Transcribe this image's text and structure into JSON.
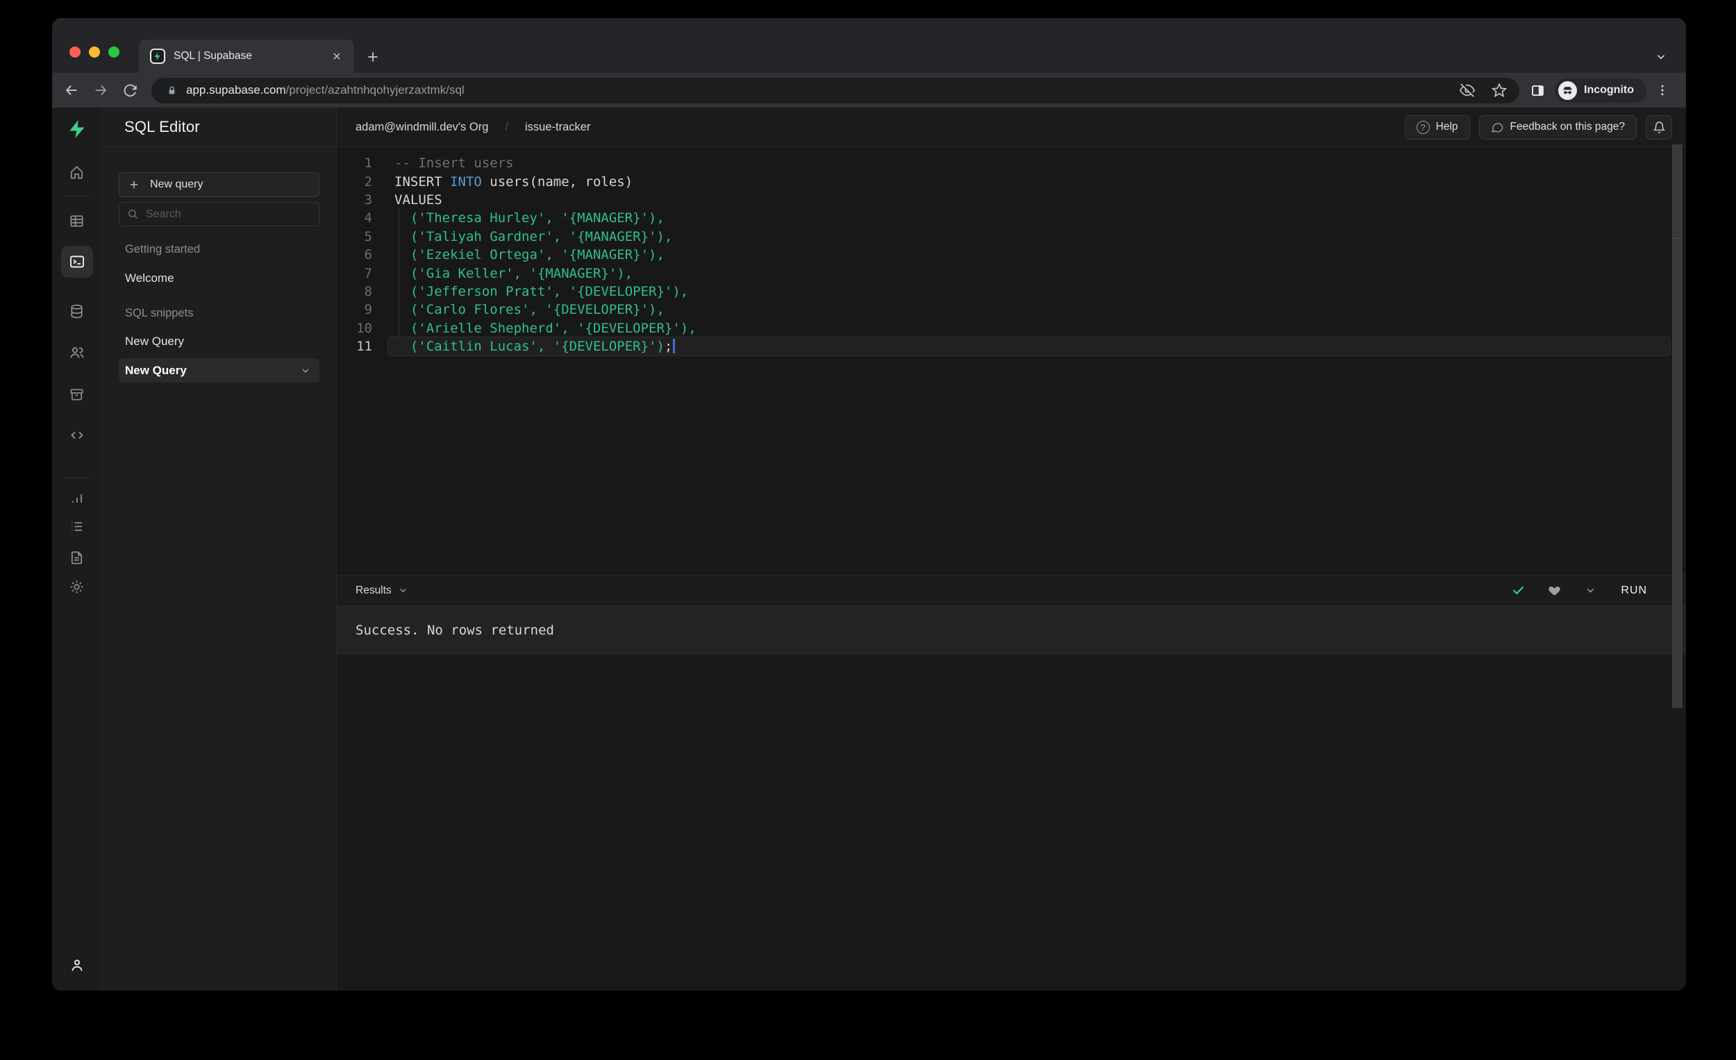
{
  "browser": {
    "tab_title": "SQL | Supabase",
    "url_host": "app.supabase.com",
    "url_path": "/project/azahtnhqohyjerzaxtmk/sql",
    "incognito_label": "Incognito",
    "icons": [
      "supabase-favicon",
      "close-tab-icon",
      "new-tab-icon",
      "tab-search-icon",
      "back-icon",
      "forward-icon",
      "reload-icon",
      "lock-icon",
      "eye-off-icon",
      "star-icon",
      "side-panel-icon",
      "incognito-spy-icon",
      "menu-dots-icon"
    ]
  },
  "sidebar": {
    "icons": [
      "supabase-logo",
      "home-icon",
      "table-editor-icon",
      "sql-editor-icon",
      "database-icon",
      "auth-users-icon",
      "storage-icon",
      "edge-functions-icon",
      "reports-icon",
      "logs-icon",
      "docs-icon",
      "settings-icon",
      "account-icon"
    ],
    "active_icon": "sql-editor-icon"
  },
  "panel": {
    "title": "SQL Editor",
    "new_query_button": "New query",
    "search_placeholder": "Search",
    "sections": [
      {
        "label": "Getting started",
        "items": [
          "Welcome"
        ]
      },
      {
        "label": "SQL snippets",
        "items": [
          "New Query",
          "New Query"
        ]
      }
    ]
  },
  "header": {
    "breadcrumb_org": "adam@windmill.dev's Org",
    "breadcrumb_sep": "/",
    "breadcrumb_project": "issue-tracker",
    "help_label": "Help",
    "help_glyph": "?",
    "feedback_label": "Feedback on this page?"
  },
  "editor": {
    "lines": [
      {
        "num": 1,
        "tokens": [
          {
            "t": "comment",
            "s": "-- Insert users"
          }
        ]
      },
      {
        "num": 2,
        "tokens": [
          {
            "t": "plain",
            "s": "INSERT "
          },
          {
            "t": "keyword",
            "s": "INTO"
          },
          {
            "t": "plain",
            "s": " users(name, roles)"
          }
        ]
      },
      {
        "num": 3,
        "tokens": [
          {
            "t": "plain",
            "s": "VALUES"
          }
        ]
      },
      {
        "num": 4,
        "tokens": [
          {
            "t": "string",
            "s": "  ('Theresa Hurley', '{MANAGER}'),"
          }
        ]
      },
      {
        "num": 5,
        "tokens": [
          {
            "t": "string",
            "s": "  ('Taliyah Gardner', '{MANAGER}'),"
          }
        ]
      },
      {
        "num": 6,
        "tokens": [
          {
            "t": "string",
            "s": "  ('Ezekiel Ortega', '{MANAGER}'),"
          }
        ]
      },
      {
        "num": 7,
        "tokens": [
          {
            "t": "string",
            "s": "  ('Gia Keller', '{MANAGER}'),"
          }
        ]
      },
      {
        "num": 8,
        "tokens": [
          {
            "t": "string",
            "s": "  ('Jefferson Pratt', '{DEVELOPER}'),"
          }
        ]
      },
      {
        "num": 9,
        "tokens": [
          {
            "t": "string",
            "s": "  ('Carlo Flores', '{DEVELOPER}'),"
          }
        ]
      },
      {
        "num": 10,
        "tokens": [
          {
            "t": "string",
            "s": "  ('Arielle Shepherd', '{DEVELOPER}'),"
          }
        ]
      },
      {
        "num": 11,
        "active": true,
        "cursor": true,
        "tokens": [
          {
            "t": "string",
            "s": "  ('Caitlin Lucas', '{DEVELOPER}')"
          },
          {
            "t": "plain",
            "s": ";"
          }
        ]
      }
    ]
  },
  "results": {
    "label": "Results",
    "run_label": "RUN",
    "message": "Success. No rows returned"
  },
  "colors": {
    "accent_green": "#3ecf8e",
    "string_green": "#2fc08a",
    "keyword_blue": "#569cd6",
    "comment_gray": "#6f6f6f"
  }
}
